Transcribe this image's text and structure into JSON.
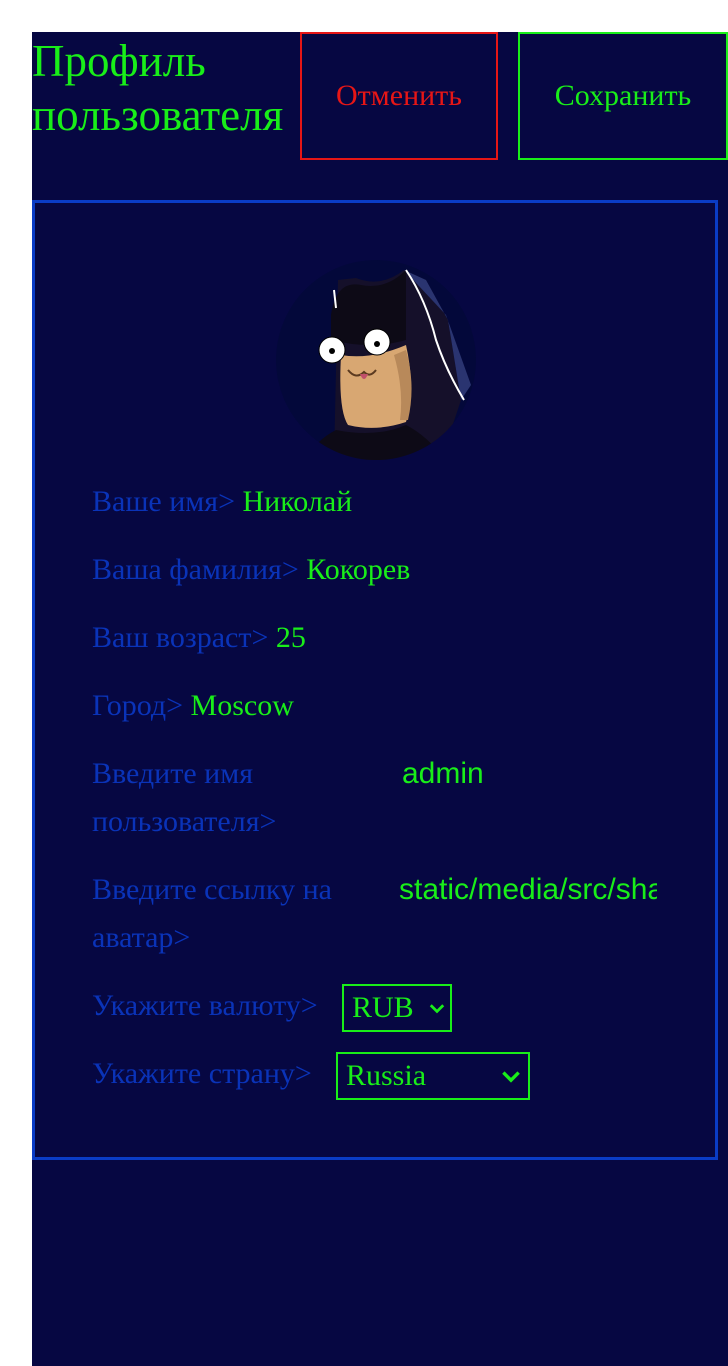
{
  "header": {
    "title": "Профиль пользователя",
    "cancel_label": "Отменить",
    "save_label": "Сохранить"
  },
  "profile": {
    "name_label": "Ваше имя>",
    "name_value": "Николай",
    "surname_label": "Ваша фамилия>",
    "surname_value": "Кокорев",
    "age_label": "Ваш возраст>",
    "age_value": "25",
    "city_label": "Город>",
    "city_value": "Moscow",
    "username_label": "Введите имя пользователя>",
    "username_value": "admin",
    "avatar_label": "Введите ссылку на аватар>",
    "avatar_value": "static/media/src/shar",
    "currency_label": "Укажите валюту>",
    "currency_value": "RUB",
    "country_label": "Укажите страну>",
    "country_value": "Russia"
  },
  "colors": {
    "background": "#060742",
    "accent": "#19ee19",
    "label": "#0a33b8",
    "cancel": "#e61616",
    "border": "#0a3cc6"
  },
  "icons": {
    "avatar": "batman-avatar-icon",
    "dropdown": "chevron-down-icon"
  }
}
